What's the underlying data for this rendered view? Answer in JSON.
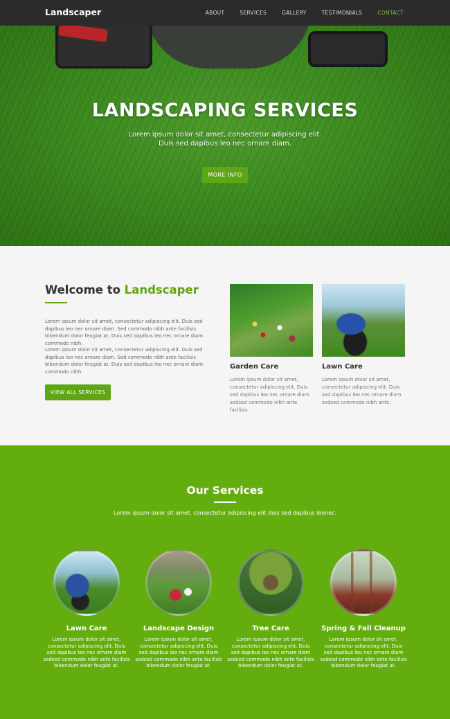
{
  "nav": {
    "brand": "Landscaper",
    "items": [
      "ABOUT",
      "SERVICES",
      "GALLERY",
      "TESTIMONIALS",
      "CONTACT"
    ],
    "active_item": "CONTACT"
  },
  "hero": {
    "title": "LANDSCAPING SERVICES",
    "subtitle_line1": "Lorem ipsum dolor sit amet, consectetur adipiscing elit.",
    "subtitle_line2": "Duis sed dapibus leo nec ornare diam.",
    "button": "MORE INFO"
  },
  "welcome": {
    "heading_prefix": "Welcome to ",
    "heading_highlight": "Landscaper",
    "paragraph1": "Lorem ipsum dolor sit amet, consectetur adipiscing elit. Duis sed dapibus leo nec ornare diam. Sed commodo nibh ante facilisis bibendum dolor feugiat at. Duis sed dapibus leo nec ornare diam commodo nibh.",
    "paragraph2": "Lorem ipsum dolor sit amet, consectetur adipiscing elit. Duis sed dapibus leo nec ornare diam. Sed commodo nibh ante facilisis bibendum dolor feugiat at. Duis sed dapibus leo nec ornare diam commodo nibh.",
    "button": "VIEW ALL SERVICES",
    "cards": [
      {
        "title": "Garden Care",
        "text": "Lorem ipsum dolor sit amet, consectetur adipiscing elit. Duis sed dapibus leo nec ornare diam sedsed commodo nibh ante facilisis."
      },
      {
        "title": "Lawn Care",
        "text": "Lorem ipsum dolor sit amet, consectetur adipiscing elit. Duis sed dapibus leo nec ornare diam sedsed commodo nibh ante."
      }
    ]
  },
  "services": {
    "title": "Our Services",
    "lead": "Lorem ipsum dolor sit amet, consectetur adipiscing elit duis sed dapibus leonec.",
    "items": [
      {
        "name": "Lawn Care",
        "text": "Lorem ipsum dolor sit amet, consectetur adipiscing elit. Duis sed dapibus leo nec ornare diam sedsed commodo nibh ante facilisis bibendum dolor feugiat at."
      },
      {
        "name": "Landscape Design",
        "text": "Lorem ipsum dolor sit amet, consectetur adipiscing elit. Duis sed dapibus leo nec ornare diam sedsed commodo nibh ante facilisis bibendum dolor feugiat at."
      },
      {
        "name": "Tree Care",
        "text": "Lorem ipsum dolor sit amet, consectetur adipiscing elit. Duis sed dapibus leo nec ornare diam sedsed commodo nibh ante facilisis bibendum dolor feugiat at."
      },
      {
        "name": "Spring & Fall Cleanup",
        "text": "Lorem ipsum dolor sit amet, consectetur adipiscing elit. Duis sed dapibus leo nec ornare diam sedsed commodo nibh ante facilisis bibendum dolor feugiat at."
      }
    ]
  },
  "colors": {
    "accent": "#5fa614",
    "navbar": "#2b2b2b",
    "services_bg": "#64ad0f"
  }
}
